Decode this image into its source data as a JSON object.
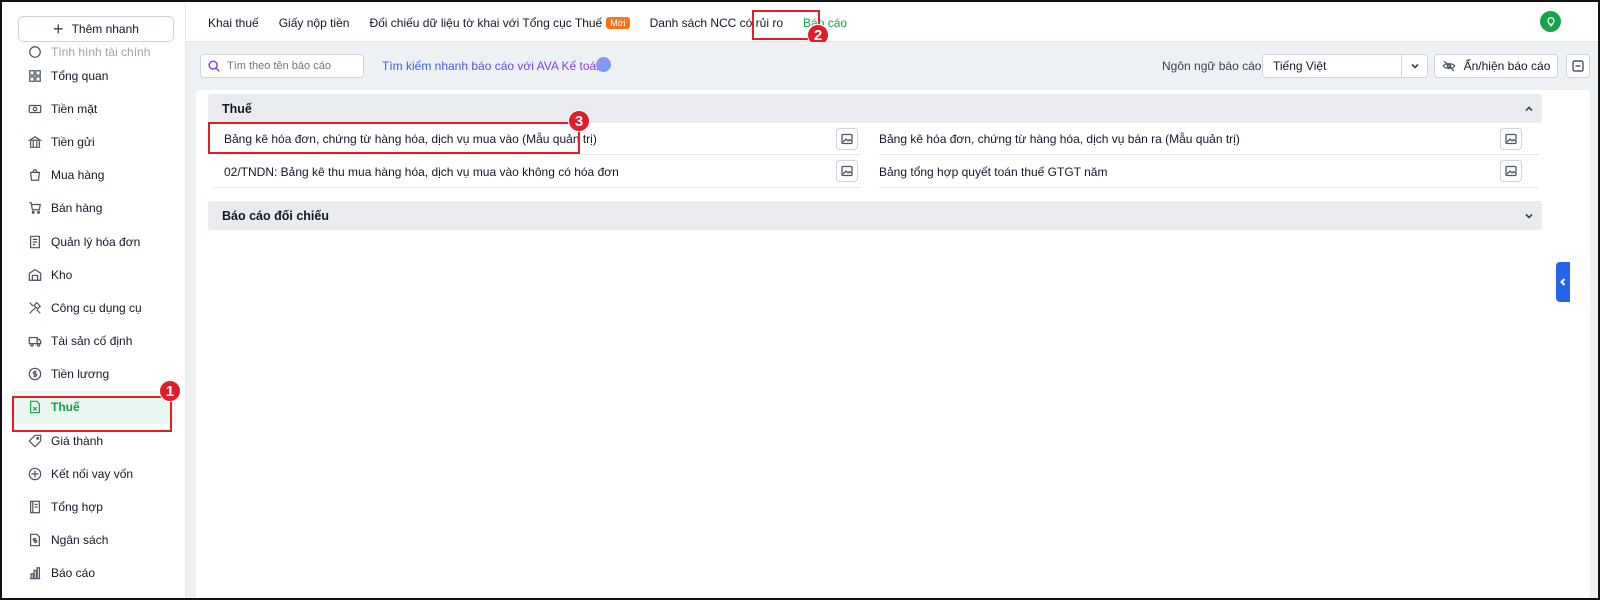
{
  "sidebar": {
    "quick_add_label": "Thêm nhanh",
    "partial_item": "Tình hình tài chính",
    "items": [
      {
        "label": "Tổng quan",
        "icon": "grid-icon"
      },
      {
        "label": "Tiền mặt",
        "icon": "cash-icon"
      },
      {
        "label": "Tiền gửi",
        "icon": "bank-icon"
      },
      {
        "label": "Mua hàng",
        "icon": "shopping-bag-icon"
      },
      {
        "label": "Bán hàng",
        "icon": "cart-icon"
      },
      {
        "label": "Quản lý hóa đơn",
        "icon": "invoice-icon"
      },
      {
        "label": "Kho",
        "icon": "warehouse-icon"
      },
      {
        "label": "Công cụ dụng cụ",
        "icon": "tools-icon"
      },
      {
        "label": "Tài sản cố định",
        "icon": "truck-icon"
      },
      {
        "label": "Tiền lương",
        "icon": "dollar-circle-icon"
      },
      {
        "label": "Thuế",
        "icon": "tax-document-icon",
        "active": true
      },
      {
        "label": "Giá thành",
        "icon": "tag-icon"
      },
      {
        "label": "Kết nối vay vốn",
        "icon": "link-loan-icon"
      },
      {
        "label": "Tổng hợp",
        "icon": "ledger-icon"
      },
      {
        "label": "Ngân sách",
        "icon": "budget-icon"
      },
      {
        "label": "Báo cáo",
        "icon": "bar-chart-icon"
      }
    ]
  },
  "header": {
    "tabs": [
      {
        "label": "Khai thuế"
      },
      {
        "label": "Giấy nộp tiền"
      },
      {
        "label": "Đối chiếu dữ liệu tờ khai với Tổng cục Thuế",
        "badge": "Mới"
      },
      {
        "label": "Danh sách NCC có rủi ro"
      },
      {
        "label": "Báo cáo",
        "active": true
      }
    ]
  },
  "toolbar": {
    "search_placeholder": "Tìm theo tên báo cáo",
    "ava_link": "Tìm kiếm nhanh báo cáo với AVA Kế toán",
    "language_label": "Ngôn ngữ báo cáo",
    "language_value": "Tiếng Việt",
    "toggle_reports_label": "Ẩn/hiện báo cáo"
  },
  "sections": [
    {
      "title": "Thuế",
      "expanded": true,
      "reports": [
        "Bảng kê hóa đơn, chứng từ hàng hóa, dịch vụ mua vào (Mẫu quản trị)",
        "Bảng kê hóa đơn, chứng từ hàng hóa, dịch vụ bán ra (Mẫu quản trị)",
        "02/TNDN: Bảng kê thu mua hàng hóa, dịch vụ mua vào không có hóa đơn",
        "Bảng tổng hợp quyết toán thuế GTGT năm"
      ]
    },
    {
      "title": "Báo cáo đối chiếu",
      "expanded": false
    }
  ],
  "markers": [
    "1",
    "2",
    "3"
  ],
  "colors": {
    "accent": "#16a34a",
    "highlight": "#e11d2a",
    "badge": "#f97316",
    "side_tab": "#2563eb"
  }
}
